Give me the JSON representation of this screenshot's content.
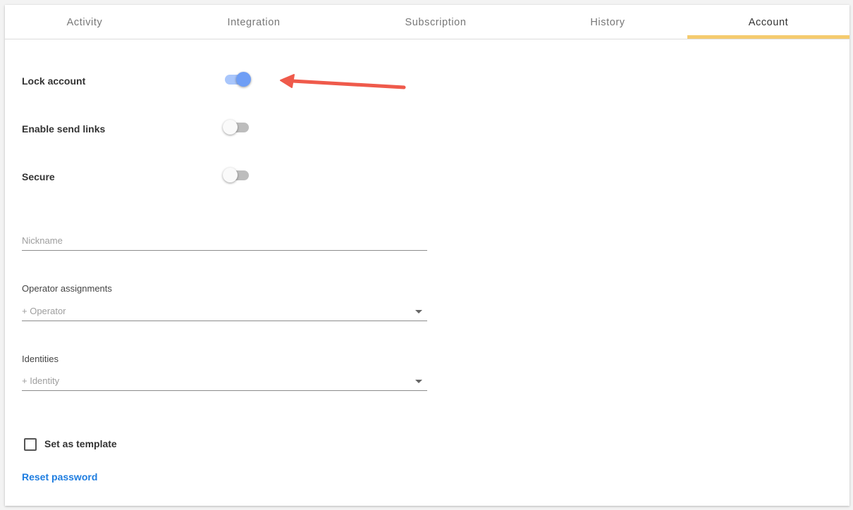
{
  "tabs": [
    {
      "label": "Activity",
      "active": false
    },
    {
      "label": "Integration",
      "active": false
    },
    {
      "label": "Subscription",
      "active": false
    },
    {
      "label": "History",
      "active": false
    },
    {
      "label": "Account",
      "active": true
    }
  ],
  "toggles": [
    {
      "label": "Lock account",
      "on": true
    },
    {
      "label": "Enable send links",
      "on": false
    },
    {
      "label": "Secure",
      "on": false
    }
  ],
  "fields": {
    "nickname": {
      "placeholder": "Nickname"
    },
    "operator": {
      "label": "Operator assignments",
      "placeholder": "+ Operator"
    },
    "identities": {
      "label": "Identities",
      "placeholder": "+ Identity"
    }
  },
  "template_checkbox": {
    "label": "Set as template",
    "checked": false
  },
  "reset_password": {
    "label": "Reset password"
  },
  "colors": {
    "accent_tab": "#f5cb6e",
    "toggle_on": "#6f9ef5",
    "link": "#1e7de0",
    "annotation_arrow": "#ef5a4b"
  }
}
